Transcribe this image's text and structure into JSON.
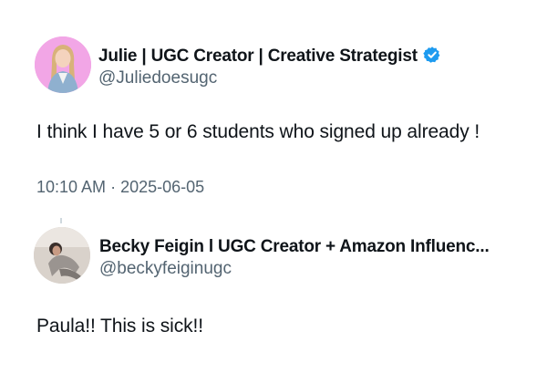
{
  "posts": [
    {
      "display_name": "Julie | UGC Creator | Creative Strategist",
      "handle": "@Juliedoesugc",
      "verified": true,
      "text": "I think I have 5 or 6 students who signed up already !",
      "time": "10:10 AM",
      "date": "2025-06-05",
      "avatar_icon": "user-avatar-icon",
      "avatar_bg": "#f2a6e6"
    },
    {
      "display_name": "Becky Feigin l UGC Creator + Amazon Influenc...",
      "handle": "@beckyfeiginugc",
      "verified": false,
      "text": "Paula!! This is sick!!",
      "avatar_icon": "user-avatar-icon",
      "avatar_bg": "#d9d2cb"
    }
  ],
  "colors": {
    "text_primary": "#0f1419",
    "text_secondary": "#536471",
    "verified_blue": "#1d9bf0"
  }
}
